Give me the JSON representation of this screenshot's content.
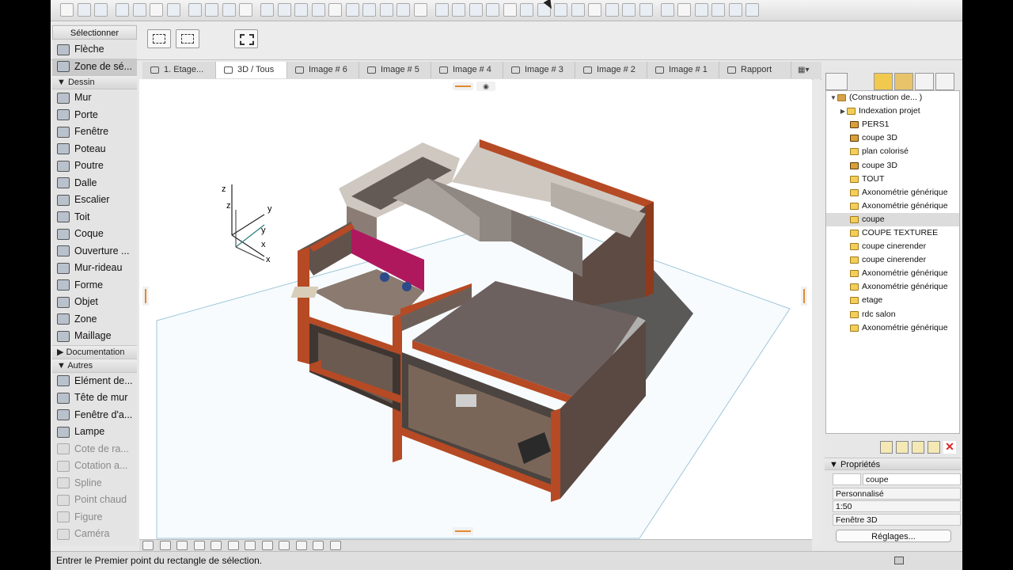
{
  "colors": {
    "wall": "#b64a24",
    "floor_tile": "#6d6160",
    "accent_magenta": "#b0185e",
    "grid_line": "#9ec7da",
    "wall_light": "#cfc8c1",
    "wall_dark": "#514742"
  },
  "toolbar": {
    "icons": [
      "new-file-icon",
      "open-file-icon",
      "save-icon",
      "print-icon",
      "cut-icon",
      "copy-icon",
      "paste-icon",
      "undo-icon",
      "redo-icon",
      "find-icon",
      "eyedropper-icon",
      "syringe-icon",
      "measure-icon",
      "guide-icon",
      "snap-icon",
      "grid-icon",
      "layers-icon",
      "pen-icon",
      "trace-icon",
      "show-icon",
      "filter-icon",
      "delete-icon",
      "fill-icon",
      "marker-icon",
      "trim-icon",
      "cut-corner-icon",
      "curve-icon",
      "split-icon",
      "explode-icon",
      "zoom-icon",
      "pin-icon",
      "stamp-icon",
      "record-icon",
      "settings-icon",
      "favorites-icon",
      "library-icon",
      "render-icon",
      "properties-icon",
      "no-icon",
      "export-icon"
    ]
  },
  "palette": {
    "select_head": "Sélectionner",
    "select_items": [
      {
        "label": "Flèche",
        "icon": "arrow-icon",
        "selected": false
      },
      {
        "label": "Zone de sé...",
        "icon": "marquee-icon",
        "selected": true
      }
    ],
    "dessin_label": "Dessin",
    "dessin_items": [
      {
        "label": "Mur",
        "icon": "wall-icon"
      },
      {
        "label": "Porte",
        "icon": "door-icon"
      },
      {
        "label": "Fenêtre",
        "icon": "window-icon"
      },
      {
        "label": "Poteau",
        "icon": "column-icon"
      },
      {
        "label": "Poutre",
        "icon": "beam-icon"
      },
      {
        "label": "Dalle",
        "icon": "slab-icon"
      },
      {
        "label": "Escalier",
        "icon": "stair-icon"
      },
      {
        "label": "Toit",
        "icon": "roof-icon"
      },
      {
        "label": "Coque",
        "icon": "shell-icon"
      },
      {
        "label": "Ouverture ...",
        "icon": "opening-icon"
      },
      {
        "label": "Mur-rideau",
        "icon": "curtain-wall-icon"
      },
      {
        "label": "Forme",
        "icon": "morph-icon"
      },
      {
        "label": "Objet",
        "icon": "object-icon"
      },
      {
        "label": "Zone",
        "icon": "zone-icon"
      },
      {
        "label": "Maillage",
        "icon": "mesh-icon"
      }
    ],
    "documentation_label": "Documentation",
    "autres_label": "Autres",
    "autres_items": [
      {
        "label": "Elément de...",
        "icon": "element-icon",
        "dim": false
      },
      {
        "label": "Tête de mur",
        "icon": "wall-end-icon",
        "dim": false
      },
      {
        "label": "Fenêtre d'a...",
        "icon": "corner-window-icon",
        "dim": false
      },
      {
        "label": "Lampe",
        "icon": "lamp-icon",
        "dim": false
      },
      {
        "label": "Cote de ra...",
        "icon": "level-dimension-icon",
        "dim": true
      },
      {
        "label": "Cotation a...",
        "icon": "angle-dimension-icon",
        "dim": true
      },
      {
        "label": "Spline",
        "icon": "spline-icon",
        "dim": true
      },
      {
        "label": "Point chaud",
        "icon": "hotspot-icon",
        "dim": true
      },
      {
        "label": "Figure",
        "icon": "figure-icon",
        "dim": true
      },
      {
        "label": "Caméra",
        "icon": "camera-icon",
        "dim": true
      }
    ]
  },
  "tabs": [
    {
      "label": "1. Etage...",
      "icon": "floor-plan-icon",
      "active": false,
      "w": 93
    },
    {
      "label": "3D / Tous",
      "icon": "3d-window-icon",
      "active": true,
      "w": 90
    },
    {
      "label": "Image # 6",
      "icon": "image-icon",
      "active": false,
      "w": 91
    },
    {
      "label": "Image # 5",
      "icon": "image-icon",
      "active": false,
      "w": 91
    },
    {
      "label": "Image # 4",
      "icon": "image-icon",
      "active": false,
      "w": 91
    },
    {
      "label": "Image # 3",
      "icon": "image-icon",
      "active": false,
      "w": 91
    },
    {
      "label": "Image # 2",
      "icon": "image-icon",
      "active": false,
      "w": 91
    },
    {
      "label": "Image # 1",
      "icon": "image-icon",
      "active": false,
      "w": 91
    },
    {
      "label": "Rapport",
      "icon": "report-icon",
      "active": false,
      "w": 91
    }
  ],
  "axes": {
    "z1": "z",
    "z2": "z",
    "y1": "y",
    "y2": "y",
    "x1": "x",
    "x2": "x"
  },
  "navigator": {
    "root": "(Construction de... )",
    "items": [
      {
        "label": "Indexation projet",
        "icon": "folder-icon",
        "arrow": "▶"
      },
      {
        "label": "PERS1",
        "icon": "camera-view-icon"
      },
      {
        "label": "coupe 3D",
        "icon": "camera-view-icon"
      },
      {
        "label": "plan colorisé",
        "icon": "view-icon"
      },
      {
        "label": "coupe 3D",
        "icon": "camera-view-icon"
      },
      {
        "label": "TOUT",
        "icon": "view-icon"
      },
      {
        "label": "Axonométrie générique",
        "icon": "view-icon"
      },
      {
        "label": "Axonométrie générique",
        "icon": "view-icon"
      },
      {
        "label": "coupe",
        "icon": "view-icon",
        "selected": true
      },
      {
        "label": "COUPE TEXTUREE",
        "icon": "view-icon"
      },
      {
        "label": "coupe cinerender",
        "icon": "view-icon"
      },
      {
        "label": "coupe cinerender",
        "icon": "view-icon"
      },
      {
        "label": "Axonométrie générique",
        "icon": "view-icon"
      },
      {
        "label": "Axonométrie générique",
        "icon": "view-icon"
      },
      {
        "label": "etage",
        "icon": "view-icon"
      },
      {
        "label": "rdc salon",
        "icon": "view-icon"
      },
      {
        "label": "Axonométrie générique",
        "icon": "view-icon"
      }
    ]
  },
  "properties": {
    "title": "Propriétés",
    "name_value": "coupe",
    "scheme": "Personnalisé",
    "scale": "1:50",
    "window_type": "Fenêtre 3D",
    "settings_button": "Réglages..."
  },
  "status": {
    "text": "Entrer le Premier point du rectangle de sélection."
  }
}
